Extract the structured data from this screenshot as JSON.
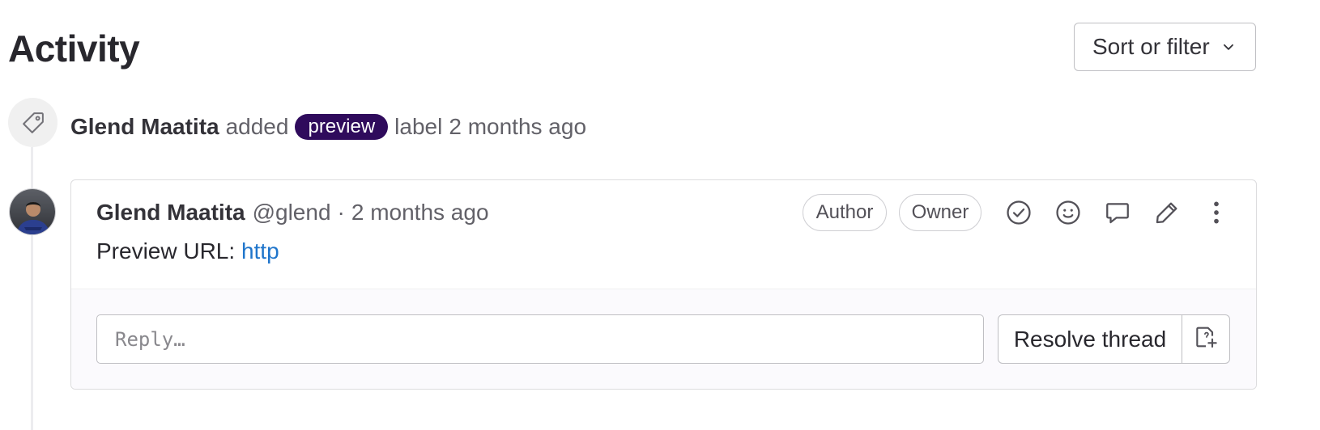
{
  "page": {
    "title": "Activity",
    "sort_button": {
      "label": "Sort or filter",
      "icon": "chevron-down-icon"
    }
  },
  "label_event": {
    "icon": "label-icon",
    "author": "Glend Maatita",
    "verb": "added",
    "label": {
      "text": "preview",
      "color": "#2f0b5c"
    },
    "suffix": "label",
    "time": "2 months ago"
  },
  "note": {
    "author": "Glend Maatita",
    "handle": "@glend",
    "separator": "·",
    "time": "2 months ago",
    "badges": [
      "Author",
      "Owner"
    ],
    "actions": [
      "resolve-icon",
      "emoji-icon",
      "reply-icon",
      "edit-icon",
      "more-actions-icon"
    ],
    "body": {
      "prefix": "Preview URL:",
      "link": "http"
    },
    "reply": {
      "placeholder": "Reply…",
      "resolve_label": "Resolve thread",
      "issue_icon": "create-issue-icon"
    }
  },
  "colors": {
    "accent_link": "#1f75cb",
    "label_bg": "#2f0b5c",
    "border": "#bfbfc3"
  }
}
